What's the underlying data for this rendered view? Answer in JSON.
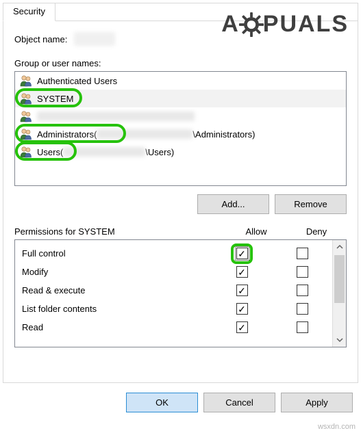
{
  "tab": {
    "label": "Security"
  },
  "object_name_label": "Object name:",
  "group_label": "Group or user names:",
  "users_list": {
    "items": [
      {
        "name": "Authenticated Users",
        "suffix": "",
        "blurred": false,
        "blurWidth": 0,
        "highlight": false
      },
      {
        "name": "SYSTEM",
        "suffix": "",
        "blurred": false,
        "blurWidth": 0,
        "highlight": true,
        "selected": true
      },
      {
        "name": "",
        "suffix": "",
        "blurred": true,
        "blurWidth": 230,
        "highlight": false
      },
      {
        "name": "Administrators",
        "suffix": "\\Administrators)",
        "blurred": true,
        "blurWidth": 140,
        "highlight": true,
        "paren": " ("
      },
      {
        "name": "Users",
        "suffix": "\\Users)",
        "blurred": true,
        "blurWidth": 120,
        "highlight": true,
        "paren": " ("
      }
    ]
  },
  "buttons": {
    "add": "Add...",
    "remove": "Remove",
    "ok": "OK",
    "cancel": "Cancel",
    "apply": "Apply"
  },
  "permissions_for_label": "Permissions for SYSTEM",
  "allow_label": "Allow",
  "deny_label": "Deny",
  "permissions": [
    {
      "name": "Full control",
      "allow": true,
      "deny": false,
      "highlight": true,
      "focus": true
    },
    {
      "name": "Modify",
      "allow": true,
      "deny": false
    },
    {
      "name": "Read & execute",
      "allow": true,
      "deny": false
    },
    {
      "name": "List folder contents",
      "allow": true,
      "deny": false
    },
    {
      "name": "Read",
      "allow": true,
      "deny": false
    }
  ],
  "watermark": {
    "brand_left": "A",
    "brand_right": "PUALS"
  },
  "source_watermark": "wsxdn.com",
  "colors": {
    "highlight": "#26c20a",
    "button_primary_bg": "#cfe4f7",
    "button_primary_border": "#2a8dd4"
  }
}
